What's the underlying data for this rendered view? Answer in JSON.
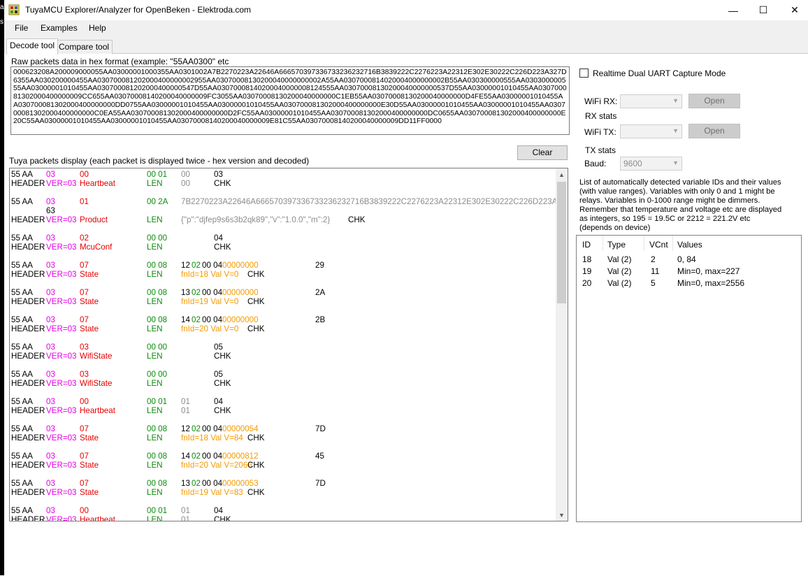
{
  "window": {
    "title": "TuyaMCU Explorer/Analyzer for OpenBeken - Elektroda.com",
    "minimize": "—",
    "maximize": "☐",
    "close": "✕"
  },
  "menu": [
    "File",
    "Examples",
    "Help"
  ],
  "tabs": [
    "Decode tool",
    "Compare tool"
  ],
  "left_strip": [
    "al",
    "s"
  ],
  "raw": {
    "label": "Raw packets data in hex format (example: \"55AA0300\" etc",
    "value": "000623208A200009000055AA03000001000355AA0301002A7B2270223A22646A666570397336733236232716B3839222C2276223A22312E302E30222C226D223A327D6355AA030200000455AA030700081202000400000002955AA03070008130200040000000002A55AA0307000814020004000000002B55AA030300000555AA030300000555AA03000001010455AA030700081202000400000547D55AA03070008140200040000008124555AA03070008130200040000000537D55AA03000001010455AA030700081302000400000009CC655AA03070008140200040000009FC3055AA03070008130200040000000C1EB55AA03070008130200040000000D4FE55AA03000001010455AA030700081302000400000000DD0755AA03000001010455AA03000001010455AA030700081302000400000000E30D55AA03000001010455AA03000001010455AA030700081302000400000000C0EA55AA030700081302000400000000D2FC55AA03000001010455AA030700081302000400000000DC0655AA030700081302000400000000E20C55AA03000001010455AA03000001010455AA03070008140200040000009E81C55AA03070008140200040000009DD11FF0000"
  },
  "packets_label": "Tuya packets display (each packet is displayed twice - hex version and decoded)",
  "clear_button": "Clear",
  "packets": [
    {
      "hex": [
        [
          "55 AA",
          "black",
          0
        ],
        [
          "03",
          "mag",
          50
        ],
        [
          "00",
          "red",
          98
        ],
        [
          "00 01",
          "green",
          194
        ],
        [
          "00",
          "gray",
          243
        ],
        [
          "03",
          "black",
          290
        ]
      ],
      "dec": [
        [
          "HEADER",
          "black",
          0
        ],
        [
          "VER=03",
          "mag",
          50
        ],
        [
          "Heartbeat",
          "red",
          98
        ],
        [
          "LEN",
          "green",
          194
        ],
        [
          "00",
          "gray",
          243
        ],
        [
          "CHK",
          "black",
          290
        ]
      ]
    },
    {
      "hex": [
        [
          "55 AA",
          "black",
          0
        ],
        [
          "03",
          "mag",
          50
        ],
        [
          "01",
          "red",
          98
        ],
        [
          "00 2A",
          "green",
          194
        ],
        [
          "7B2270223A22646A666570397336733236232716B3839222C2276223A22312E302E30222C226D223A327D",
          "gray",
          243
        ]
      ],
      "hex2": [
        [
          "63",
          "black",
          50
        ]
      ],
      "dec": [
        [
          "HEADER",
          "black",
          0
        ],
        [
          "VER=03",
          "mag",
          50
        ],
        [
          "Product",
          "red",
          98
        ],
        [
          "LEN",
          "green",
          194
        ],
        [
          "{\"p\":\"djfep9s6s3b2qk89\",\"v\":\"1.0.0\",\"m\":2}",
          "gray",
          243
        ],
        [
          "CHK",
          "black",
          482
        ]
      ]
    },
    {
      "hex": [
        [
          "55 AA",
          "black",
          0
        ],
        [
          "03",
          "mag",
          50
        ],
        [
          "02",
          "red",
          98
        ],
        [
          "00 00",
          "green",
          194
        ],
        [
          "04",
          "black",
          290
        ]
      ],
      "dec": [
        [
          "HEADER",
          "black",
          0
        ],
        [
          "VER=03",
          "mag",
          50
        ],
        [
          "McuConf",
          "red",
          98
        ],
        [
          "LEN",
          "green",
          194
        ],
        [
          "CHK",
          "black",
          290
        ]
      ]
    },
    {
      "hex": [
        [
          "55 AA",
          "black",
          0
        ],
        [
          "03",
          "mag",
          50
        ],
        [
          "07",
          "red",
          98
        ],
        [
          "00 08",
          "green",
          194
        ],
        [
          "12",
          "black",
          243
        ],
        [
          "02",
          "green",
          258
        ],
        [
          "00 04",
          "black",
          273
        ],
        [
          "00000000",
          "orange",
          302
        ],
        [
          "29",
          "black",
          435
        ]
      ],
      "dec": [
        [
          "HEADER",
          "black",
          0
        ],
        [
          "VER=03",
          "mag",
          50
        ],
        [
          "State",
          "red",
          98
        ],
        [
          "LEN",
          "green",
          194
        ],
        [
          "fnId=18 Val V=0",
          "orange",
          243
        ],
        [
          "CHK",
          "black",
          338
        ]
      ]
    },
    {
      "hex": [
        [
          "55 AA",
          "black",
          0
        ],
        [
          "03",
          "mag",
          50
        ],
        [
          "07",
          "red",
          98
        ],
        [
          "00 08",
          "green",
          194
        ],
        [
          "13",
          "black",
          243
        ],
        [
          "02",
          "green",
          258
        ],
        [
          "00 04",
          "black",
          273
        ],
        [
          "00000000",
          "orange",
          302
        ],
        [
          "2A",
          "black",
          435
        ]
      ],
      "dec": [
        [
          "HEADER",
          "black",
          0
        ],
        [
          "VER=03",
          "mag",
          50
        ],
        [
          "State",
          "red",
          98
        ],
        [
          "LEN",
          "green",
          194
        ],
        [
          "fnId=19 Val V=0",
          "orange",
          243
        ],
        [
          "CHK",
          "black",
          338
        ]
      ]
    },
    {
      "hex": [
        [
          "55 AA",
          "black",
          0
        ],
        [
          "03",
          "mag",
          50
        ],
        [
          "07",
          "red",
          98
        ],
        [
          "00 08",
          "green",
          194
        ],
        [
          "14",
          "black",
          243
        ],
        [
          "02",
          "green",
          258
        ],
        [
          "00 04",
          "black",
          273
        ],
        [
          "00000000",
          "orange",
          302
        ],
        [
          "2B",
          "black",
          435
        ]
      ],
      "dec": [
        [
          "HEADER",
          "black",
          0
        ],
        [
          "VER=03",
          "mag",
          50
        ],
        [
          "State",
          "red",
          98
        ],
        [
          "LEN",
          "green",
          194
        ],
        [
          "fnId=20 Val V=0",
          "orange",
          243
        ],
        [
          "CHK",
          "black",
          338
        ]
      ]
    },
    {
      "hex": [
        [
          "55 AA",
          "black",
          0
        ],
        [
          "03",
          "mag",
          50
        ],
        [
          "03",
          "red",
          98
        ],
        [
          "00 00",
          "green",
          194
        ],
        [
          "05",
          "black",
          290
        ]
      ],
      "dec": [
        [
          "HEADER",
          "black",
          0
        ],
        [
          "VER=03",
          "mag",
          50
        ],
        [
          "WifiState",
          "red",
          98
        ],
        [
          "LEN",
          "green",
          194
        ],
        [
          "CHK",
          "black",
          290
        ]
      ]
    },
    {
      "hex": [
        [
          "55 AA",
          "black",
          0
        ],
        [
          "03",
          "mag",
          50
        ],
        [
          "03",
          "red",
          98
        ],
        [
          "00 00",
          "green",
          194
        ],
        [
          "05",
          "black",
          290
        ]
      ],
      "dec": [
        [
          "HEADER",
          "black",
          0
        ],
        [
          "VER=03",
          "mag",
          50
        ],
        [
          "WifiState",
          "red",
          98
        ],
        [
          "LEN",
          "green",
          194
        ],
        [
          "CHK",
          "black",
          290
        ]
      ]
    },
    {
      "hex": [
        [
          "55 AA",
          "black",
          0
        ],
        [
          "03",
          "mag",
          50
        ],
        [
          "00",
          "red",
          98
        ],
        [
          "00 01",
          "green",
          194
        ],
        [
          "01",
          "gray",
          243
        ],
        [
          "04",
          "black",
          290
        ]
      ],
      "dec": [
        [
          "HEADER",
          "black",
          0
        ],
        [
          "VER=03",
          "mag",
          50
        ],
        [
          "Heartbeat",
          "red",
          98
        ],
        [
          "LEN",
          "green",
          194
        ],
        [
          "01",
          "gray",
          243
        ],
        [
          "CHK",
          "black",
          290
        ]
      ]
    },
    {
      "hex": [
        [
          "55 AA",
          "black",
          0
        ],
        [
          "03",
          "mag",
          50
        ],
        [
          "07",
          "red",
          98
        ],
        [
          "00 08",
          "green",
          194
        ],
        [
          "12",
          "black",
          243
        ],
        [
          "02",
          "green",
          258
        ],
        [
          "00 04",
          "black",
          273
        ],
        [
          "00000054",
          "orange",
          302
        ],
        [
          "7D",
          "black",
          435
        ]
      ],
      "dec": [
        [
          "HEADER",
          "black",
          0
        ],
        [
          "VER=03",
          "mag",
          50
        ],
        [
          "State",
          "red",
          98
        ],
        [
          "LEN",
          "green",
          194
        ],
        [
          "fnId=18 Val V=84",
          "orange",
          243
        ],
        [
          "CHK",
          "black",
          338
        ]
      ]
    },
    {
      "hex": [
        [
          "55 AA",
          "black",
          0
        ],
        [
          "03",
          "mag",
          50
        ],
        [
          "07",
          "red",
          98
        ],
        [
          "00 08",
          "green",
          194
        ],
        [
          "14",
          "black",
          243
        ],
        [
          "02",
          "green",
          258
        ],
        [
          "00 04",
          "black",
          273
        ],
        [
          "00000812",
          "orange",
          302
        ],
        [
          "45",
          "black",
          435
        ]
      ],
      "dec": [
        [
          "HEADER",
          "black",
          0
        ],
        [
          "VER=03",
          "mag",
          50
        ],
        [
          "State",
          "red",
          98
        ],
        [
          "LEN",
          "green",
          194
        ],
        [
          "fnId=20 Val V=2066",
          "orange",
          243
        ],
        [
          "CHK",
          "black",
          338
        ]
      ]
    },
    {
      "hex": [
        [
          "55 AA",
          "black",
          0
        ],
        [
          "03",
          "mag",
          50
        ],
        [
          "07",
          "red",
          98
        ],
        [
          "00 08",
          "green",
          194
        ],
        [
          "13",
          "black",
          243
        ],
        [
          "02",
          "green",
          258
        ],
        [
          "00 04",
          "black",
          273
        ],
        [
          "00000053",
          "orange",
          302
        ],
        [
          "7D",
          "black",
          435
        ]
      ],
      "dec": [
        [
          "HEADER",
          "black",
          0
        ],
        [
          "VER=03",
          "mag",
          50
        ],
        [
          "State",
          "red",
          98
        ],
        [
          "LEN",
          "green",
          194
        ],
        [
          "fnId=19 Val V=83",
          "orange",
          243
        ],
        [
          "CHK",
          "black",
          338
        ]
      ]
    },
    {
      "hex": [
        [
          "55 AA",
          "black",
          0
        ],
        [
          "03",
          "mag",
          50
        ],
        [
          "00",
          "red",
          98
        ],
        [
          "00 01",
          "green",
          194
        ],
        [
          "01",
          "gray",
          243
        ],
        [
          "04",
          "black",
          290
        ]
      ],
      "dec": [
        [
          "HEADER",
          "black",
          0
        ],
        [
          "VER=03",
          "mag",
          50
        ],
        [
          "Heartbeat",
          "red",
          98
        ],
        [
          "LEN",
          "green",
          194
        ],
        [
          "01",
          "gray",
          243
        ],
        [
          "CHK",
          "black",
          290
        ]
      ]
    }
  ],
  "right": {
    "realtime_label": "Realtime Dual UART Capture Mode",
    "wifi_rx_label": "WiFi RX:",
    "rx_stats": "RX stats",
    "wifi_tx_label": "WiFi TX:",
    "tx_stats": "TX stats",
    "baud_label": "Baud:",
    "baud_value": "9600",
    "open_label": "Open",
    "vars_desc": "List of automatically detected variable IDs  and their values (with value ranges). Variables with only 0 and 1 might be relays. Variables in 0-1000 range might be dimmers. Remember that temperature and voltage etc are displayed as integers, so 195 = 19.5C or 2212 = 221.2V etc (depends on device)",
    "vars_headers": [
      "ID",
      "Type",
      "VCnt",
      "Values"
    ],
    "vars_rows": [
      [
        "18",
        "Val (2)",
        "2",
        "0, 84"
      ],
      [
        "19",
        "Val (2)",
        "11",
        "Min=0, max=227"
      ],
      [
        "20",
        "Val (2)",
        "5",
        "Min=0, max=2556"
      ]
    ]
  }
}
